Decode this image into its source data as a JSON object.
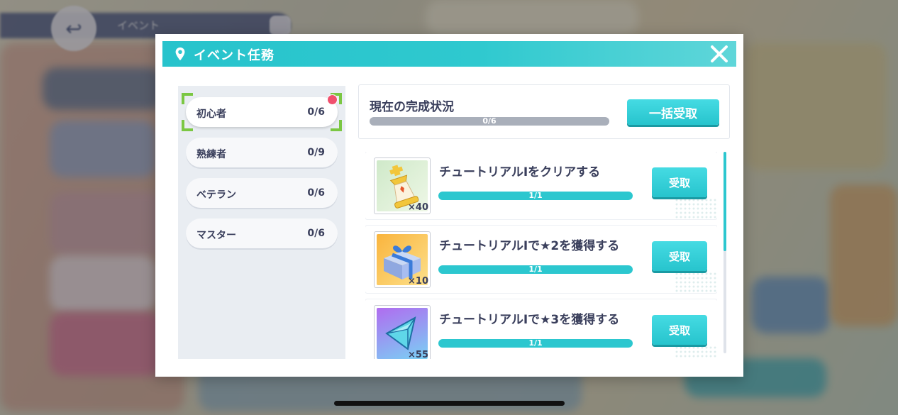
{
  "background": {
    "topbar_label": "イベント"
  },
  "modal": {
    "title": "イベント任務",
    "close_label": "✕",
    "categories": [
      {
        "name": "初心者",
        "count": "0/6",
        "active": true,
        "has_notification": true
      },
      {
        "name": "熟練者",
        "count": "0/9",
        "active": false,
        "has_notification": false
      },
      {
        "name": "ベテラン",
        "count": "0/6",
        "active": false,
        "has_notification": false
      },
      {
        "name": "マスター",
        "count": "0/6",
        "active": false,
        "has_notification": false
      }
    ],
    "summary": {
      "title": "現在の完成状況",
      "progress_text": "0/6",
      "progress": 0.0,
      "bulk_claim_label": "一括受取"
    },
    "tasks": [
      {
        "text": "チュートリアルⅠをクリアする",
        "progress_text": "1/1",
        "progress": 1.0,
        "reward_icon": "chess-king-icon",
        "reward_qty": "×40",
        "claim_label": "受取"
      },
      {
        "text": "チュートリアルⅠで★2を獲得する",
        "progress_text": "1/1",
        "progress": 1.0,
        "reward_icon": "gift-box-icon",
        "reward_qty": "×10",
        "claim_label": "受取"
      },
      {
        "text": "チュートリアルⅠで★3を獲得する",
        "progress_text": "1/1",
        "progress": 1.0,
        "reward_icon": "crystal-gem-icon",
        "reward_qty": "×55",
        "claim_label": "受取"
      }
    ]
  },
  "colors": {
    "accent": "#2cc7cf",
    "text": "#3a3f5c",
    "notification": "#f0506e",
    "active_corner": "#7bc743"
  }
}
